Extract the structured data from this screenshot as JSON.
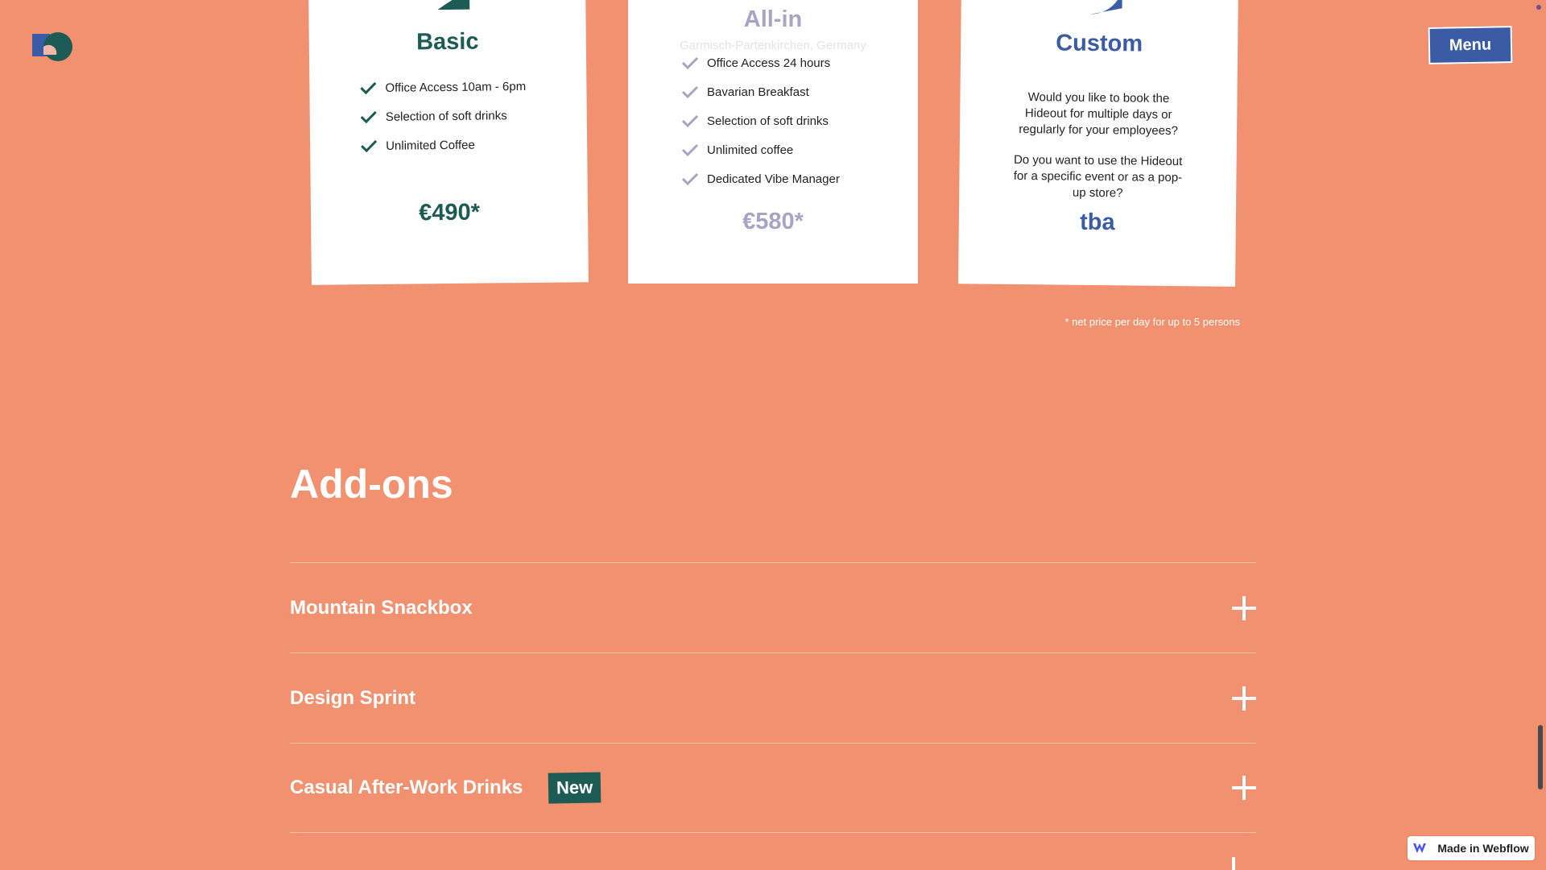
{
  "header": {
    "menu_label": "Menu"
  },
  "plans": [
    {
      "title": "Basic",
      "features": [
        "Office Access 10am - 6pm",
        "Selection of soft drinks",
        "Unlimited Coffee"
      ],
      "price": "€490*"
    },
    {
      "title": "All-in",
      "subtitle": "Garmisch-Partenkirchen, Germany",
      "features": [
        "Office Access 24 hours",
        "Bavarian Breakfast",
        "Selection of soft drinks",
        "Unlimited coffee",
        "Dedicated Vibe Manager"
      ],
      "price": "€580*"
    },
    {
      "title": "Custom",
      "paragraphs": [
        "Would you like to book the Hideout for multiple days or regularly for your employees?",
        "Do you want to use the Hideout for a specific event or as a pop-up store?"
      ],
      "price": "tba"
    }
  ],
  "price_note": "* net price per day for up to 5 persons",
  "addons": {
    "title": "Add-ons",
    "items": [
      {
        "title": "Mountain Snackbox"
      },
      {
        "title": "Design Sprint"
      },
      {
        "title": "Casual After-Work Drinks",
        "badge": "New"
      }
    ]
  },
  "webflow_badge": "Made in Webflow",
  "colors": {
    "background": "#F2916F",
    "basic": "#1D5B55",
    "allin": "#A6A6C2",
    "custom": "#3B5BA5"
  }
}
